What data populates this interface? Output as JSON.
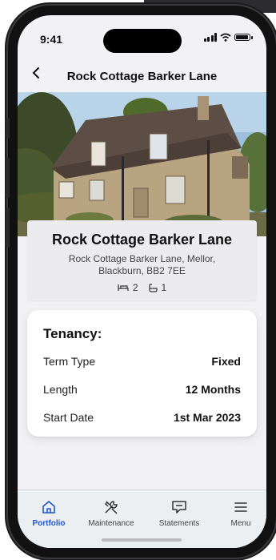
{
  "status_bar": {
    "time": "9:41"
  },
  "header": {
    "back_icon": "chevron-left-icon",
    "title": "Rock Cottage Barker Lane"
  },
  "property": {
    "name": "Rock Cottage Barker Lane",
    "address": "Rock Cottage Barker Lane, Mellor, Blackburn, BB2 7EE",
    "bedrooms": "2",
    "bathrooms": "1"
  },
  "tenancy": {
    "title": "Tenancy:",
    "rows": [
      {
        "label": "Term Type",
        "value": "Fixed"
      },
      {
        "label": "Length",
        "value": "12 Months"
      },
      {
        "label": "Start Date",
        "value": "1st Mar 2023"
      }
    ]
  },
  "tabs": [
    {
      "label": "Portfolio",
      "icon": "home-icon",
      "active": true
    },
    {
      "label": "Maintenance",
      "icon": "tools-icon",
      "active": false
    },
    {
      "label": "Statements",
      "icon": "message-icon",
      "active": false
    },
    {
      "label": "Menu",
      "icon": "menu-icon",
      "active": false
    }
  ],
  "colors": {
    "accent": "#1f56c9",
    "background": "#f2f2f4"
  }
}
